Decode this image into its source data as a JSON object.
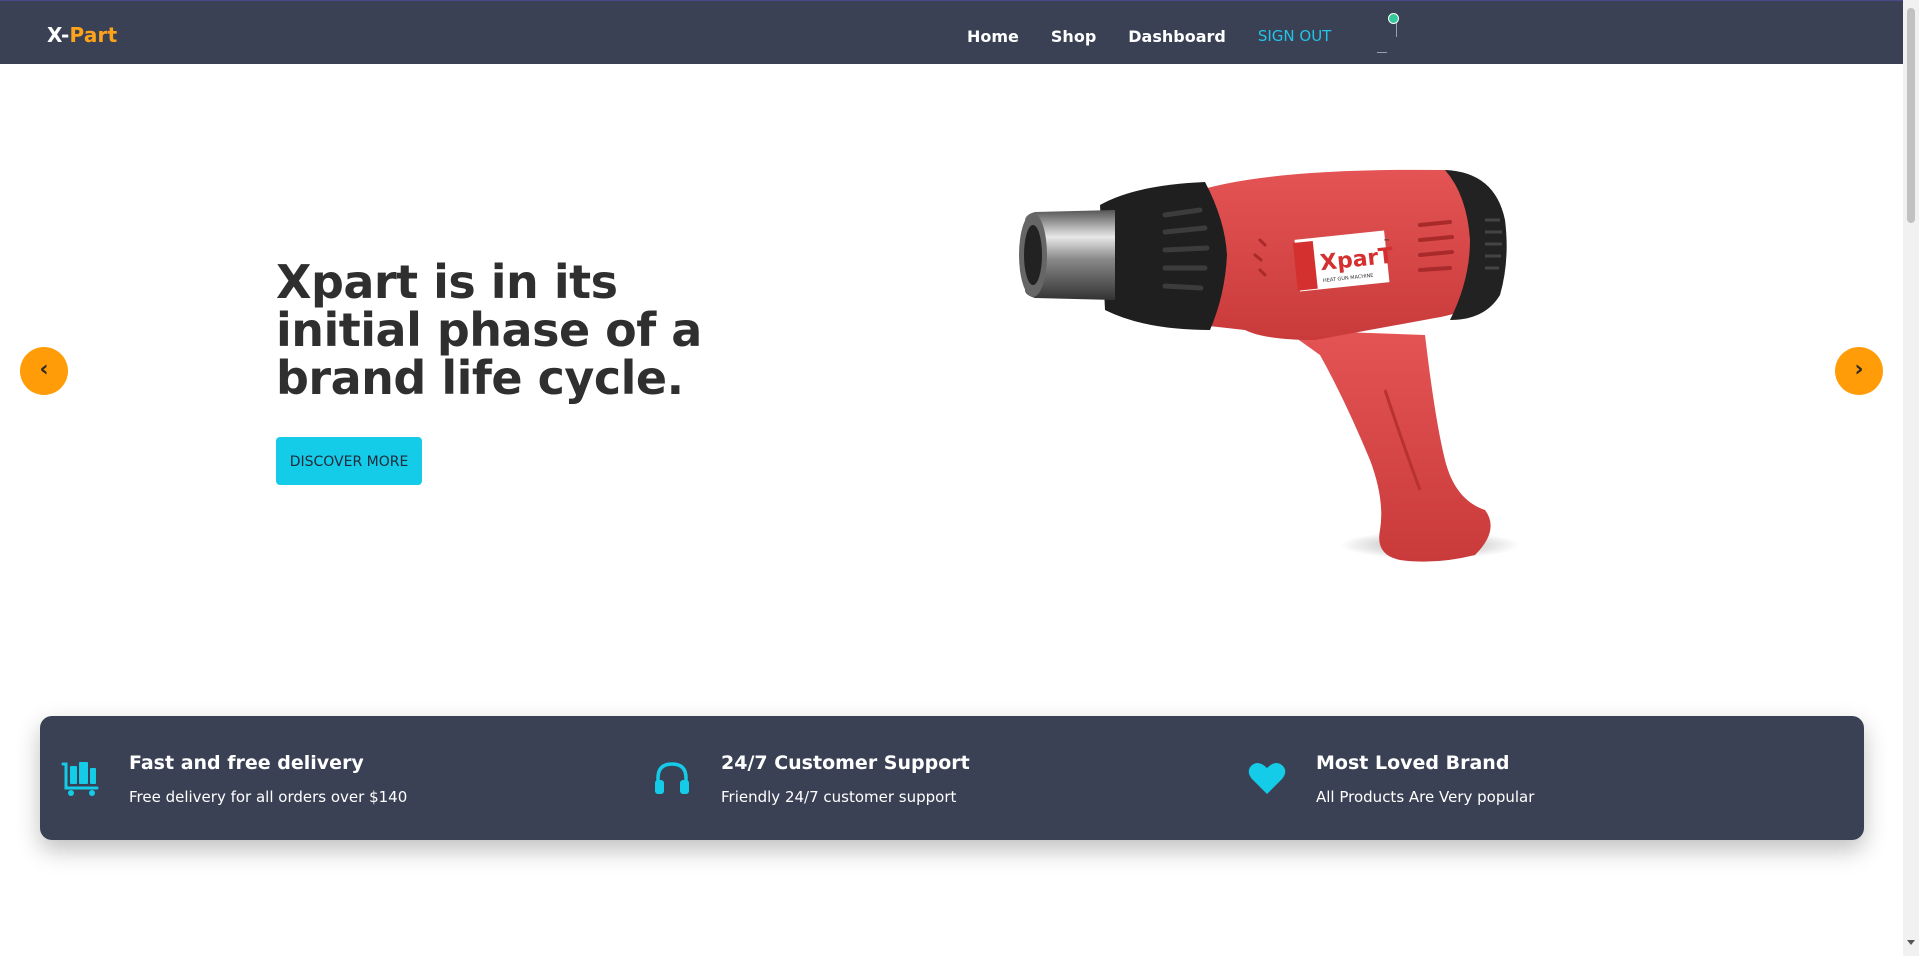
{
  "navbar": {
    "brand_prefix": "X-",
    "brand_suffix": "Part",
    "links": [
      "Home",
      "Shop",
      "Dashboard"
    ],
    "signout_label": "SIGN OUT"
  },
  "hero": {
    "title": "Xpart is in its initial phase of a brand life cycle.",
    "button_label": "DISCOVER MORE",
    "prev_label": "‹",
    "next_label": "›",
    "product_brand": "XparT",
    "product_subtitle": "HEAT GUN MACHINE",
    "product_trademark": "™"
  },
  "features": [
    {
      "icon": "delivery-cart-icon",
      "title": "Fast and free delivery",
      "desc": "Free delivery for all orders over $140"
    },
    {
      "icon": "headphones-icon",
      "title": "24/7 Customer Support",
      "desc": "Friendly 24/7 customer support"
    },
    {
      "icon": "heart-icon",
      "title": "Most Loved Brand",
      "desc": "All Products Are Very popular"
    }
  ],
  "colors": {
    "navbar_bg": "#3a4154",
    "brand_accent": "#ffa31a",
    "signout": "#22c4e8",
    "button": "#14cbe8",
    "arrow": "#ff9c07",
    "feature_icon": "#14cbe8",
    "product_red": "#e04848"
  }
}
